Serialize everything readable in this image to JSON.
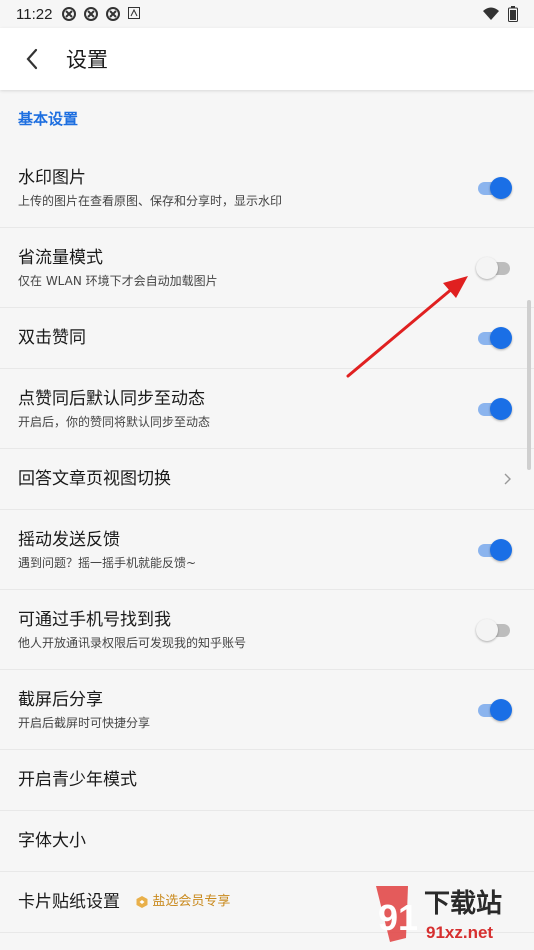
{
  "status_bar": {
    "time": "11:22"
  },
  "app_bar": {
    "title": "设置"
  },
  "section": {
    "title": "基本设置"
  },
  "settings": [
    {
      "label": "水印图片",
      "sub": "上传的图片在查看原图、保存和分享时，显示水印",
      "control": "toggle",
      "on": true
    },
    {
      "label": "省流量模式",
      "sub": "仅在 WLAN 环境下才会自动加载图片",
      "control": "toggle",
      "on": false
    },
    {
      "label": "双击赞同",
      "control": "toggle",
      "on": true
    },
    {
      "label": "点赞同后默认同步至动态",
      "sub": "开启后，你的赞同将默认同步至动态",
      "control": "toggle",
      "on": true
    },
    {
      "label": "回答文章页视图切换",
      "control": "chevron"
    },
    {
      "label": "摇动发送反馈",
      "sub": "遇到问题？摇一摇手机就能反馈~",
      "control": "toggle",
      "on": true
    },
    {
      "label": "可通过手机号找到我",
      "sub": "他人开放通讯录权限后可发现我的知乎账号",
      "control": "toggle",
      "on": false
    },
    {
      "label": "截屏后分享",
      "sub": "开启后截屏时可快捷分享",
      "control": "toggle",
      "on": true
    },
    {
      "label": "开启青少年模式",
      "control": "none"
    },
    {
      "label": "字体大小",
      "control": "none"
    },
    {
      "label": "卡片贴纸设置",
      "badge": "盐选会员专享",
      "control": "none"
    }
  ],
  "watermark": {
    "brand": "下载站",
    "domain": "91xz.net",
    "logo_digits": "91"
  },
  "colors": {
    "accent": "#1a6fe6",
    "annotation_arrow": "#e02020",
    "badge": "#c98a1e"
  }
}
